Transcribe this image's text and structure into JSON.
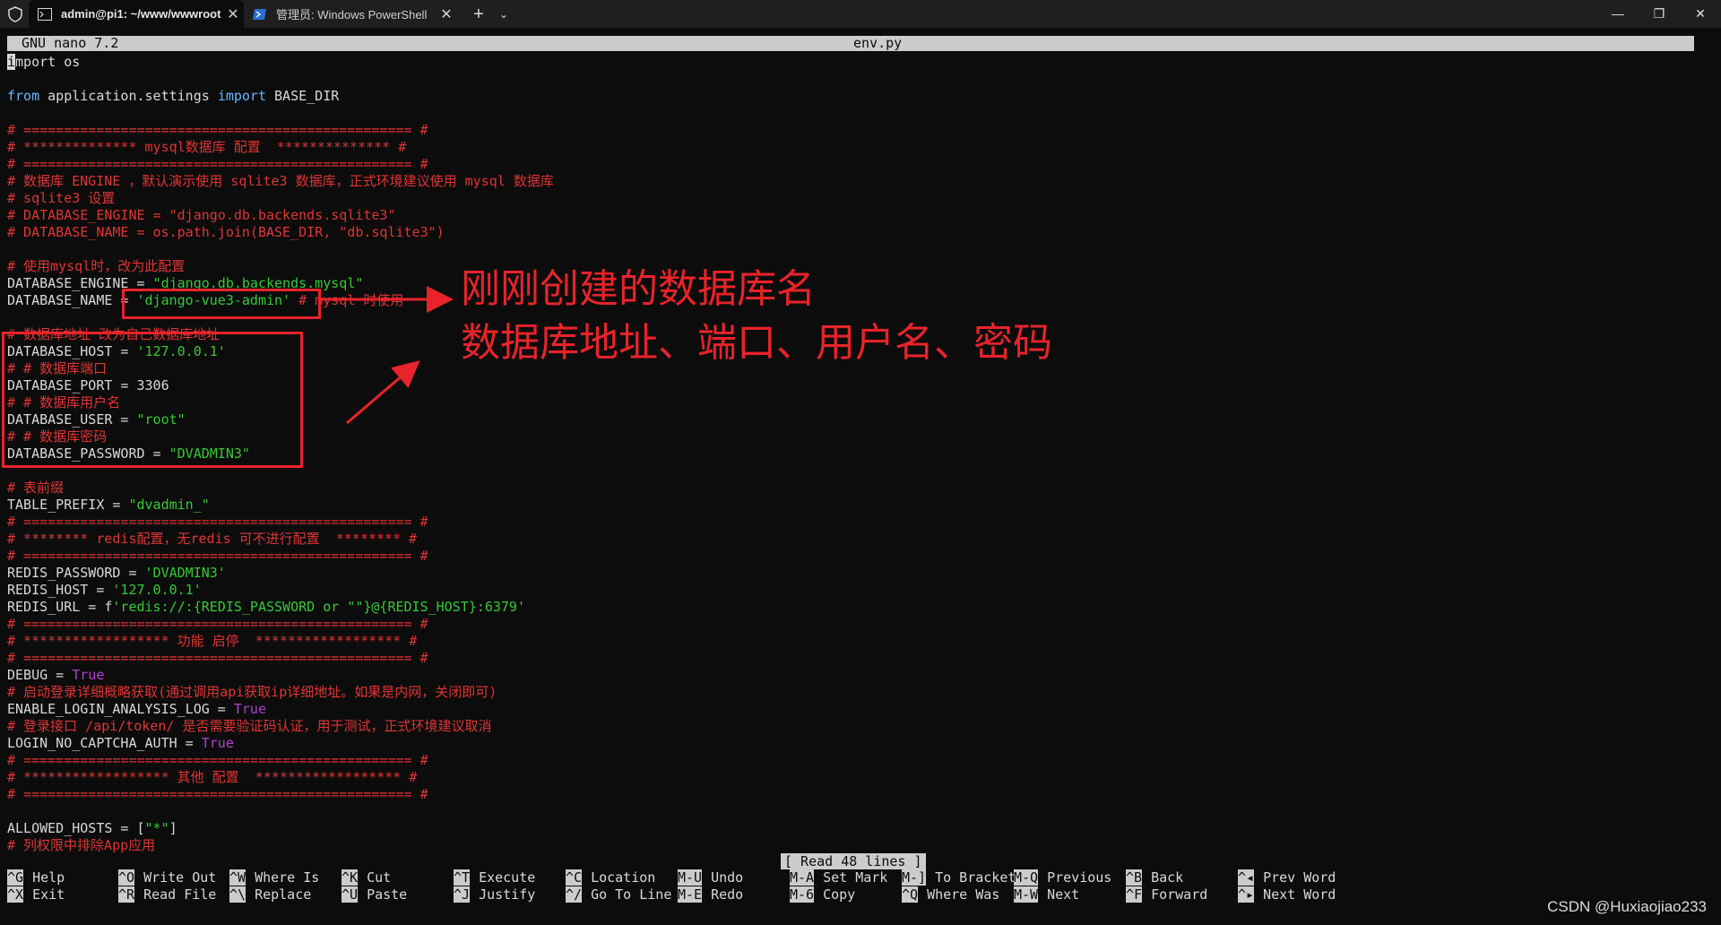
{
  "window": {
    "tabs": [
      {
        "label": "admin@pi1: ~/www/wwwroot",
        "active": true
      },
      {
        "label": "管理员: Windows PowerShell",
        "active": false
      }
    ],
    "new_tab": "+",
    "tab_dropdown": "⌄",
    "minimize": "—",
    "restore": "❐",
    "close": "✕",
    "tab_close": "✕"
  },
  "nano": {
    "version": "GNU nano 7.2",
    "filename": "env.py",
    "status": "[ Read 48 lines ]"
  },
  "code": [
    [
      {
        "t": "i",
        "s": "cursor"
      },
      {
        "t": "mport os"
      }
    ],
    [],
    [
      {
        "t": "from",
        "s": "kw"
      },
      {
        "t": " application.settings "
      },
      {
        "t": "import",
        "s": "kw"
      },
      {
        "t": " BASE_DIR"
      }
    ],
    [],
    [
      {
        "t": "# ================================================ #",
        "s": "c"
      }
    ],
    [
      {
        "t": "# ************** mysql数据库 配置  ************** #",
        "s": "c"
      }
    ],
    [
      {
        "t": "# ================================================ #",
        "s": "c"
      }
    ],
    [
      {
        "t": "# 数据库 ENGINE ，默认演示使用 sqlite3 数据库，正式环境建议使用 mysql 数据库",
        "s": "c"
      }
    ],
    [
      {
        "t": "# sqlite3 设置",
        "s": "c"
      }
    ],
    [
      {
        "t": "# DATABASE_ENGINE = \"django.db.backends.sqlite3\"",
        "s": "c"
      }
    ],
    [
      {
        "t": "# DATABASE_NAME = os.path.join(BASE_DIR, \"db.sqlite3\")",
        "s": "c"
      }
    ],
    [],
    [
      {
        "t": "# 使用mysql时，改为此配置",
        "s": "c"
      }
    ],
    [
      {
        "t": "DATABASE_ENGINE = "
      },
      {
        "t": "\"django.db.backends.mysql\"",
        "s": "s"
      }
    ],
    [
      {
        "t": "DATABASE_NAME = "
      },
      {
        "t": "'django-vue3-admin'",
        "s": "s"
      },
      {
        "t": " # mysql 时使用",
        "s": "c"
      }
    ],
    [],
    [
      {
        "t": "# 数据库地址 改为自己数据库地址",
        "s": "c"
      }
    ],
    [
      {
        "t": "DATABASE_HOST = "
      },
      {
        "t": "'127.0.0.1'",
        "s": "s"
      }
    ],
    [
      {
        "t": "# # 数据库端口",
        "s": "c"
      }
    ],
    [
      {
        "t": "DATABASE_PORT = 3306"
      }
    ],
    [
      {
        "t": "# # 数据库用户名",
        "s": "c"
      }
    ],
    [
      {
        "t": "DATABASE_USER = "
      },
      {
        "t": "\"root\"",
        "s": "s"
      }
    ],
    [
      {
        "t": "# # 数据库密码",
        "s": "c"
      }
    ],
    [
      {
        "t": "DATABASE_PASSWORD = "
      },
      {
        "t": "\"DVADMIN3\"",
        "s": "s"
      }
    ],
    [],
    [
      {
        "t": "# 表前缀",
        "s": "c"
      }
    ],
    [
      {
        "t": "TABLE_PREFIX = "
      },
      {
        "t": "\"dvadmin_\"",
        "s": "s"
      }
    ],
    [
      {
        "t": "# ================================================ #",
        "s": "c"
      }
    ],
    [
      {
        "t": "# ******** redis配置，无redis 可不进行配置  ******** #",
        "s": "c"
      }
    ],
    [
      {
        "t": "# ================================================ #",
        "s": "c"
      }
    ],
    [
      {
        "t": "REDIS_PASSWORD = "
      },
      {
        "t": "'DVADMIN3'",
        "s": "s"
      }
    ],
    [
      {
        "t": "REDIS_HOST = "
      },
      {
        "t": "'127.0.0.1'",
        "s": "s"
      }
    ],
    [
      {
        "t": "REDIS_URL = f"
      },
      {
        "t": "'redis://:{REDIS_PASSWORD or \"\"}@{REDIS_HOST}:6379'",
        "s": "s"
      }
    ],
    [
      {
        "t": "# ================================================ #",
        "s": "c"
      }
    ],
    [
      {
        "t": "# ****************** 功能 启停  ****************** #",
        "s": "c"
      }
    ],
    [
      {
        "t": "# ================================================ #",
        "s": "c"
      }
    ],
    [
      {
        "t": "DEBUG = "
      },
      {
        "t": "True",
        "s": "b"
      }
    ],
    [
      {
        "t": "# 启动登录详细概略获取(通过调用api获取ip详细地址。如果是内网，关闭即可)",
        "s": "c"
      }
    ],
    [
      {
        "t": "ENABLE_LOGIN_ANALYSIS_LOG = "
      },
      {
        "t": "True",
        "s": "b"
      }
    ],
    [
      {
        "t": "# 登录接口 /api/token/ 是否需要验证码认证，用于测试，正式环境建议取消",
        "s": "c"
      }
    ],
    [
      {
        "t": "LOGIN_NO_CAPTCHA_AUTH = "
      },
      {
        "t": "True",
        "s": "b"
      }
    ],
    [
      {
        "t": "# ================================================ #",
        "s": "c"
      }
    ],
    [
      {
        "t": "# ****************** 其他 配置  ****************** #",
        "s": "c"
      }
    ],
    [
      {
        "t": "# ================================================ #",
        "s": "c"
      }
    ],
    [],
    [
      {
        "t": "ALLOWED_HOSTS = ["
      },
      {
        "t": "\"*\"",
        "s": "s"
      },
      {
        "t": "]"
      }
    ],
    [
      {
        "t": "# 列权限中排除App应用",
        "s": "c"
      }
    ]
  ],
  "annotations": {
    "db_name_note": "刚刚创建的数据库名",
    "db_conn_note": "数据库地址、端口、用户名、密码"
  },
  "shortcuts": [
    {
      "k1": "^G",
      "l1": "Help",
      "k2": "^X",
      "l2": "Exit"
    },
    {
      "k1": "^O",
      "l1": "Write Out",
      "k2": "^R",
      "l2": "Read File"
    },
    {
      "k1": "^W",
      "l1": "Where Is",
      "k2": "^\\",
      "l2": "Replace"
    },
    {
      "k1": "^K",
      "l1": "Cut",
      "k2": "^U",
      "l2": "Paste"
    },
    {
      "k1": "^T",
      "l1": "Execute",
      "k2": "^J",
      "l2": "Justify"
    },
    {
      "k1": "^C",
      "l1": "Location",
      "k2": "^/",
      "l2": "Go To Line"
    },
    {
      "k1": "M-U",
      "l1": "Undo",
      "k2": "M-E",
      "l2": "Redo"
    },
    {
      "k1": "M-A",
      "l1": "Set Mark",
      "k2": "M-6",
      "l2": "Copy"
    },
    {
      "k1": "M-]",
      "l1": "To Bracket",
      "k2": "^Q",
      "l2": "Where Was"
    },
    {
      "k1": "M-Q",
      "l1": "Previous",
      "k2": "M-W",
      "l2": "Next"
    },
    {
      "k1": "^B",
      "l1": "Back",
      "k2": "^F",
      "l2": "Forward"
    },
    {
      "k1": "^◂",
      "l1": "Prev Word",
      "k2": "^▸",
      "l2": "Next Word"
    }
  ],
  "watermark": "CSDN @Huxiaojiao233",
  "colors": {
    "comment": "#e03434",
    "keyword": "#67b6ff",
    "string": "#35c935",
    "boolean": "#b040d0",
    "annotation": "#e8232a"
  }
}
